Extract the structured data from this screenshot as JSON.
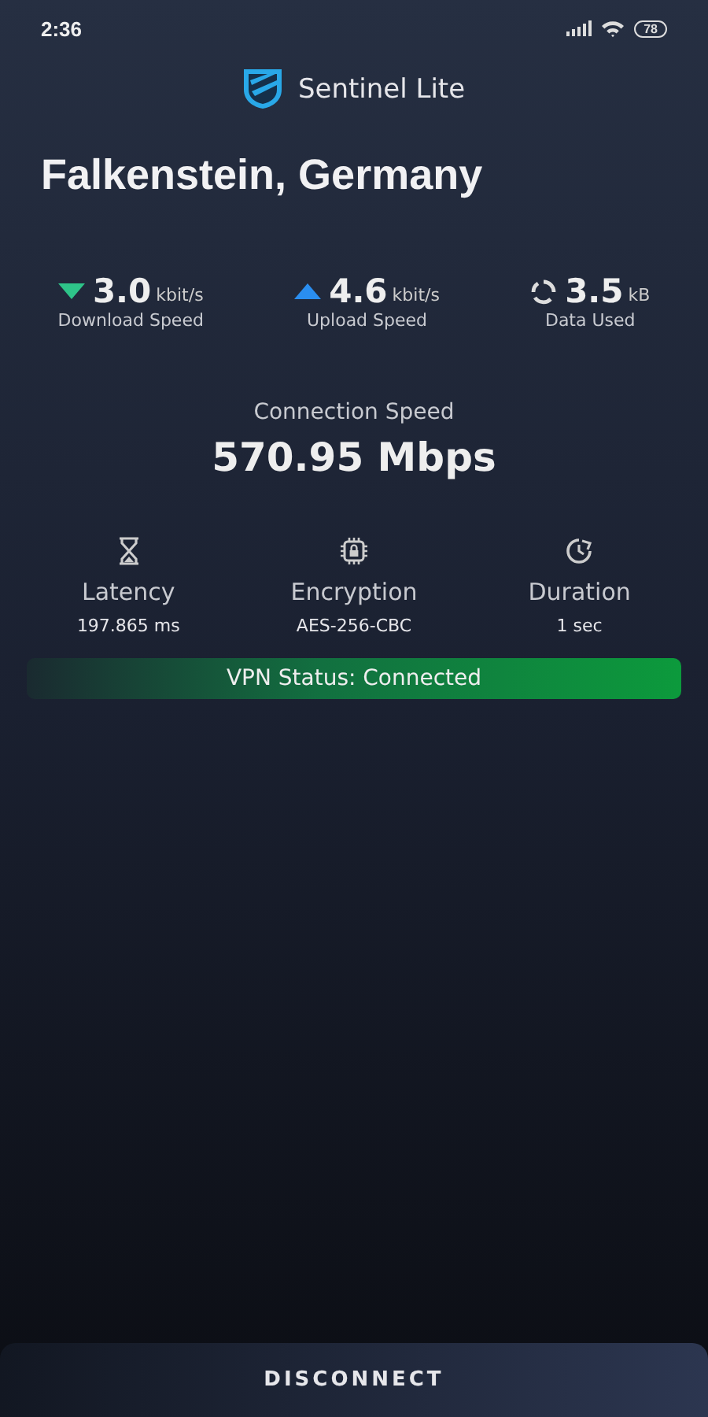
{
  "status_bar": {
    "time": "2:36",
    "battery": "78"
  },
  "app": {
    "name": "Sentinel Lite"
  },
  "location": "Falkenstein, Germany",
  "stats": [
    {
      "kind": "download",
      "value": "3.0",
      "unit": "kbit/s",
      "label": "Download Speed"
    },
    {
      "kind": "upload",
      "value": "4.6",
      "unit": "kbit/s",
      "label": "Upload Speed"
    },
    {
      "kind": "data",
      "value": "3.5",
      "unit": "kB",
      "label": "Data Used"
    }
  ],
  "connection_speed": {
    "label": "Connection Speed",
    "value": "570.95 Mbps"
  },
  "details": [
    {
      "kind": "latency",
      "label": "Latency",
      "value": "197.865 ms"
    },
    {
      "kind": "encryption",
      "label": "Encryption",
      "value": "AES-256-CBC"
    },
    {
      "kind": "duration",
      "label": "Duration",
      "value": "1 sec"
    }
  ],
  "vpn_status": {
    "text": "VPN Status: Connected",
    "connected": true
  },
  "button": "DISCONNECT"
}
